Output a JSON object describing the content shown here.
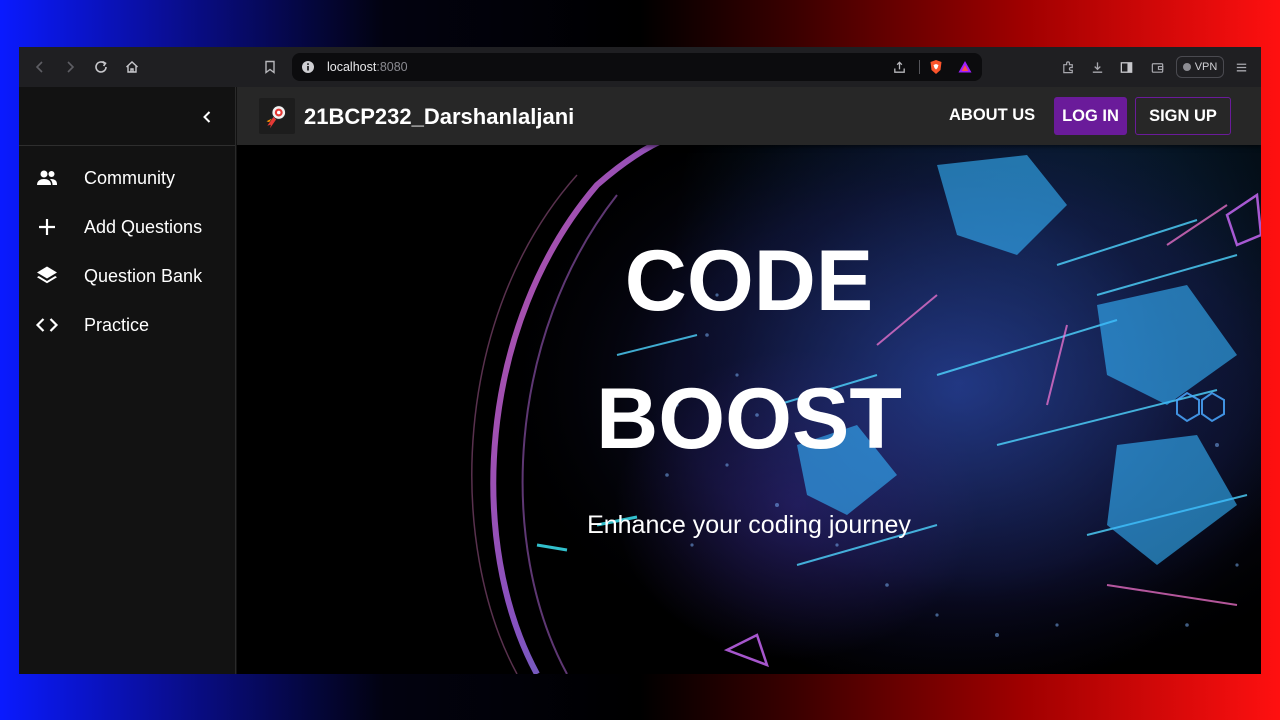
{
  "browser": {
    "url_host": "localhost",
    "url_port": ":8080",
    "vpn_label": "VPN"
  },
  "sidebar": {
    "items": [
      {
        "label": "Community",
        "icon": "people-icon"
      },
      {
        "label": "Add Questions",
        "icon": "plus-icon"
      },
      {
        "label": "Question Bank",
        "icon": "layers-icon"
      },
      {
        "label": "Practice",
        "icon": "code-icon"
      }
    ]
  },
  "appbar": {
    "brand": "21BCP232_Darshanlaljani",
    "about_label": "ABOUT US",
    "login_label": "LOG IN",
    "signup_label": "SIGN UP",
    "accent_color": "#6a1b9a"
  },
  "hero": {
    "title_line1": "CODE",
    "title_line2": "BOOST",
    "subtitle": "Enhance your coding journey"
  }
}
